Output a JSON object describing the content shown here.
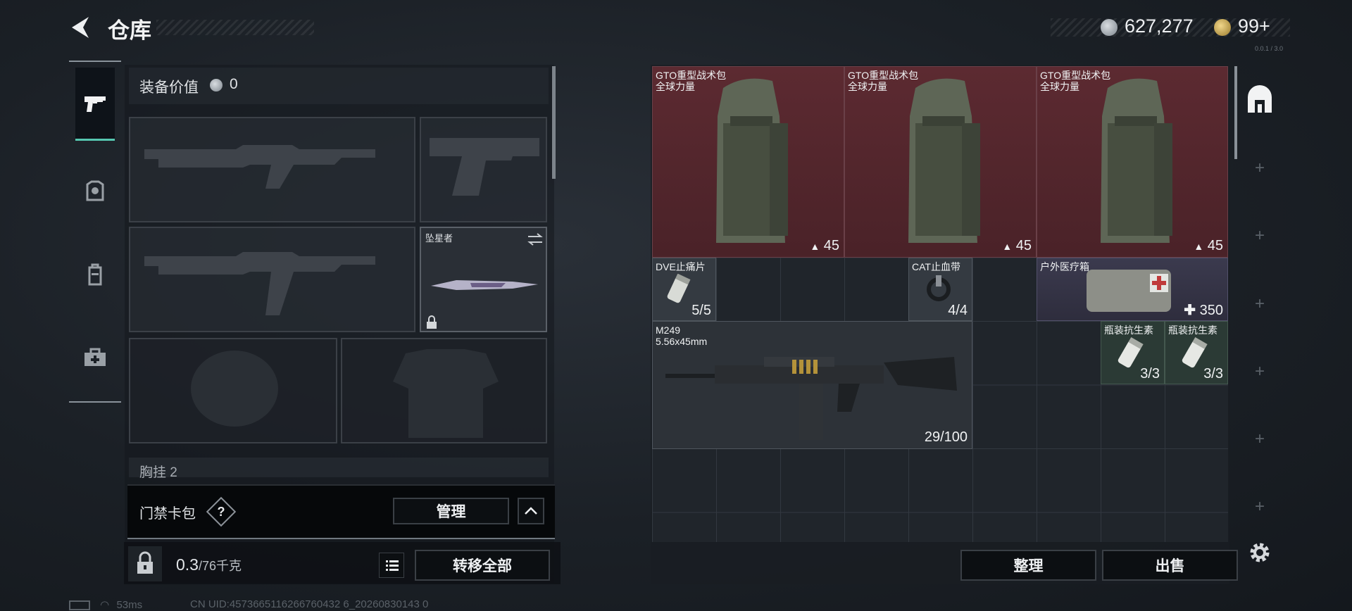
{
  "header": {
    "title": "仓库",
    "coins": "627,277",
    "tickets": "99+",
    "version_text": "0.0.1 / 3.0"
  },
  "left_tabs": [
    {
      "icon": "pistol-icon",
      "active": true
    },
    {
      "icon": "armor-icon",
      "active": false
    },
    {
      "icon": "backpack-icon",
      "active": false
    },
    {
      "icon": "medkit-icon",
      "active": false
    }
  ],
  "equipment": {
    "value_label": "装备价值",
    "value": "0",
    "melee_label": "坠星者",
    "chest_label": "胸挂",
    "chest_value": "2"
  },
  "access_card": {
    "label": "门禁卡包",
    "help": "?",
    "manage_label": "管理"
  },
  "weight": {
    "current": "0.3",
    "capacity": "/76千克",
    "transfer_label": "转移全部"
  },
  "status": {
    "ping": "53ms",
    "uid": "CN UID:4573665116266760432 6_20260830143 0"
  },
  "stash": {
    "backpacks": [
      {
        "name": "GTO重型战术包",
        "sub": "全球力量",
        "count": "45"
      },
      {
        "name": "GTO重型战术包",
        "sub": "全球力量",
        "count": "45"
      },
      {
        "name": "GTO重型战术包",
        "sub": "全球力量",
        "count": "45"
      }
    ],
    "dve": {
      "name": "DVE止痛片",
      "count": "5/5"
    },
    "cat": {
      "name": "CAT止血带",
      "count": "4/4"
    },
    "medbox": {
      "name": "户外医疗箱",
      "count": "350"
    },
    "m249": {
      "name": "M249",
      "caliber": "5.56x45mm",
      "count": "29/100"
    },
    "antibiotics": [
      {
        "name": "瓶装抗生素",
        "count": "3/3"
      },
      {
        "name": "瓶装抗生素",
        "count": "3/3"
      }
    ],
    "sort_label": "整理",
    "sell_label": "出售"
  },
  "colors": {
    "accent": "#56c7b0",
    "rare_red": "#5c2a31",
    "epic_purple": "#3b3a4e",
    "uncommon_green": "#2b3a35"
  }
}
